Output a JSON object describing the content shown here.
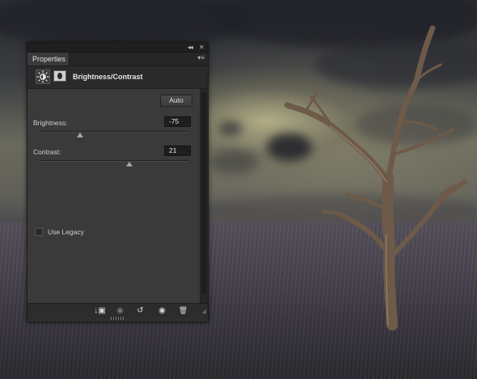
{
  "panel": {
    "collapse_glyph": "◂◂",
    "close_glyph": "✕",
    "tab_label": "Properties",
    "tab_menu_glyph": "▾≡",
    "adjustment_title": "Brightness/Contrast",
    "adjustment_icon": "brightness-contrast-icon",
    "mask_icon": "layer-mask-icon"
  },
  "controls": {
    "auto_label": "Auto",
    "brightness": {
      "label": "Brightness:",
      "value": "-75",
      "slider_fraction": 0.28
    },
    "contrast": {
      "label": "Contrast:",
      "value": "21",
      "slider_fraction": 0.61
    },
    "legacy": {
      "label": "Use Legacy",
      "checked": false
    }
  },
  "footer": {
    "buttons": [
      {
        "name": "clip-to-layer-button",
        "glyph": "↓▣"
      },
      {
        "name": "view-previous-state-button",
        "glyph": "◉"
      },
      {
        "name": "reset-button",
        "glyph": "↺"
      },
      {
        "name": "toggle-visibility-button",
        "glyph": "◉"
      },
      {
        "name": "delete-button",
        "glyph": "🗑"
      }
    ]
  },
  "colors": {
    "panel_bg": "#3a3a3a",
    "panel_dark": "#2e2e2e",
    "text": "#d0d0d0"
  }
}
